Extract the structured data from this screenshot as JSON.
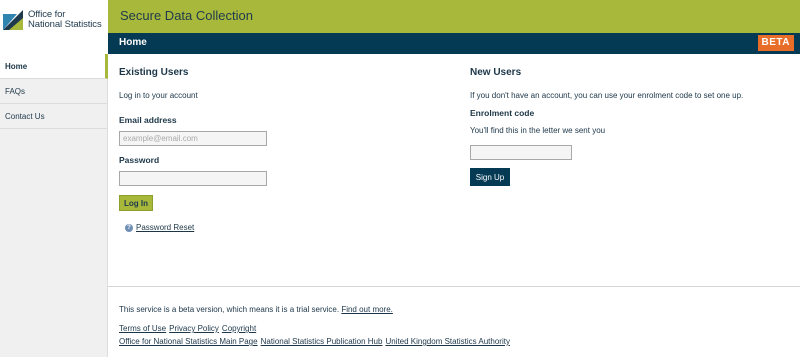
{
  "logo": {
    "line1": "Office for",
    "line2": "National Statistics"
  },
  "header": {
    "title": "Secure Data Collection"
  },
  "nav": {
    "home": "Home",
    "badge": "BETA"
  },
  "sidebar": {
    "items": [
      {
        "label": "Home"
      },
      {
        "label": "FAQs"
      },
      {
        "label": "Contact Us"
      }
    ]
  },
  "existing": {
    "heading": "Existing Users",
    "intro": "Log in to your account",
    "email_label": "Email address",
    "email_placeholder": "example@email.com",
    "email_value": "",
    "password_label": "Password",
    "login_button": "Log In",
    "reset_link": "Password Reset"
  },
  "new_users": {
    "heading": "New Users",
    "intro": "If you don't have an account, you can use your enrolment code to set one up.",
    "code_label": "Enrolment code",
    "code_hint": "You'll find this in the letter we sent you",
    "signup_button": "Sign Up"
  },
  "footer": {
    "notice": "This service is a beta version, which means it is a trial service.",
    "notice_link": "Find out more.",
    "links_row1": [
      "Terms of Use",
      "Privacy Policy",
      "Copyright"
    ],
    "links_row2": [
      "Office for National Statistics Main Page",
      "National Statistics Publication Hub",
      "United Kingdom Statistics Authority"
    ]
  },
  "colors": {
    "brand_green": "#a7b83a",
    "navy": "#053a55",
    "beta_orange": "#e86d28",
    "text": "#1c3648"
  }
}
